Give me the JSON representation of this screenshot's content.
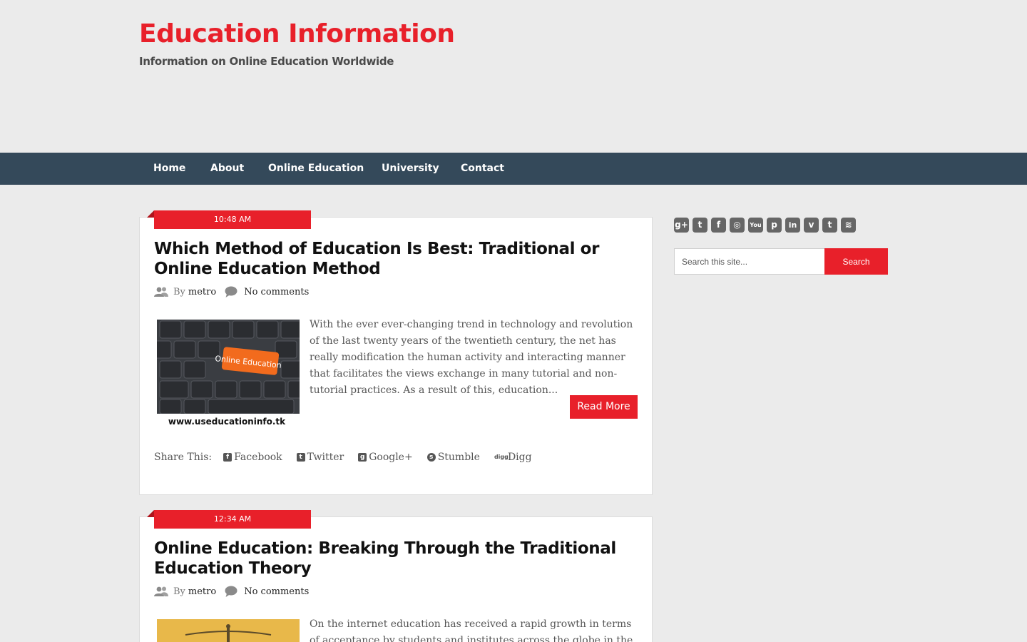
{
  "header": {
    "title": "Education Information",
    "tagline": "Information on Online Education Worldwide"
  },
  "nav": {
    "items": [
      "Home",
      "About",
      "Online Education",
      "University",
      "Contact"
    ]
  },
  "posts": [
    {
      "time": "10:48 AM",
      "title": "Which Method of Education Is Best: Traditional or Online Education Method",
      "by": "By",
      "author": "metro",
      "comments": "No comments",
      "thumb_label": "Online Education",
      "thumb_caption": "www.useducationinfo.tk",
      "excerpt": "With the ever ever-changing trend in technology and revolution of the last twenty years of the twentieth century, the net has really modification the human activity and interacting manner that facilitates the views exchange in many tutorial and non- tutorial practices. As a result of this, education...",
      "read_more": "Read More",
      "share_label": "Share This:",
      "share_links": [
        "Facebook",
        "Twitter",
        "Google+",
        "Stumble",
        "Digg"
      ]
    },
    {
      "time": "12:34 AM",
      "title": "Online Education: Breaking Through the Traditional Education Theory",
      "by": "By",
      "author": "metro",
      "comments": "No comments",
      "excerpt": "On the internet education has received a rapid growth in terms of acceptance by students and institutes across the globe in the past"
    }
  ],
  "sidebar": {
    "social_icons": [
      "google-plus-icon",
      "twitter-icon",
      "facebook-icon",
      "instagram-icon",
      "youtube-icon",
      "pinterest-icon",
      "linkedin-icon",
      "vimeo-icon",
      "tumblr-icon",
      "rss-icon"
    ],
    "search_placeholder": "Search this site...",
    "search_button": "Search"
  },
  "colors": {
    "accent": "#e8202a",
    "nav_bg": "#34495a",
    "page_bg": "#ebebeb"
  }
}
